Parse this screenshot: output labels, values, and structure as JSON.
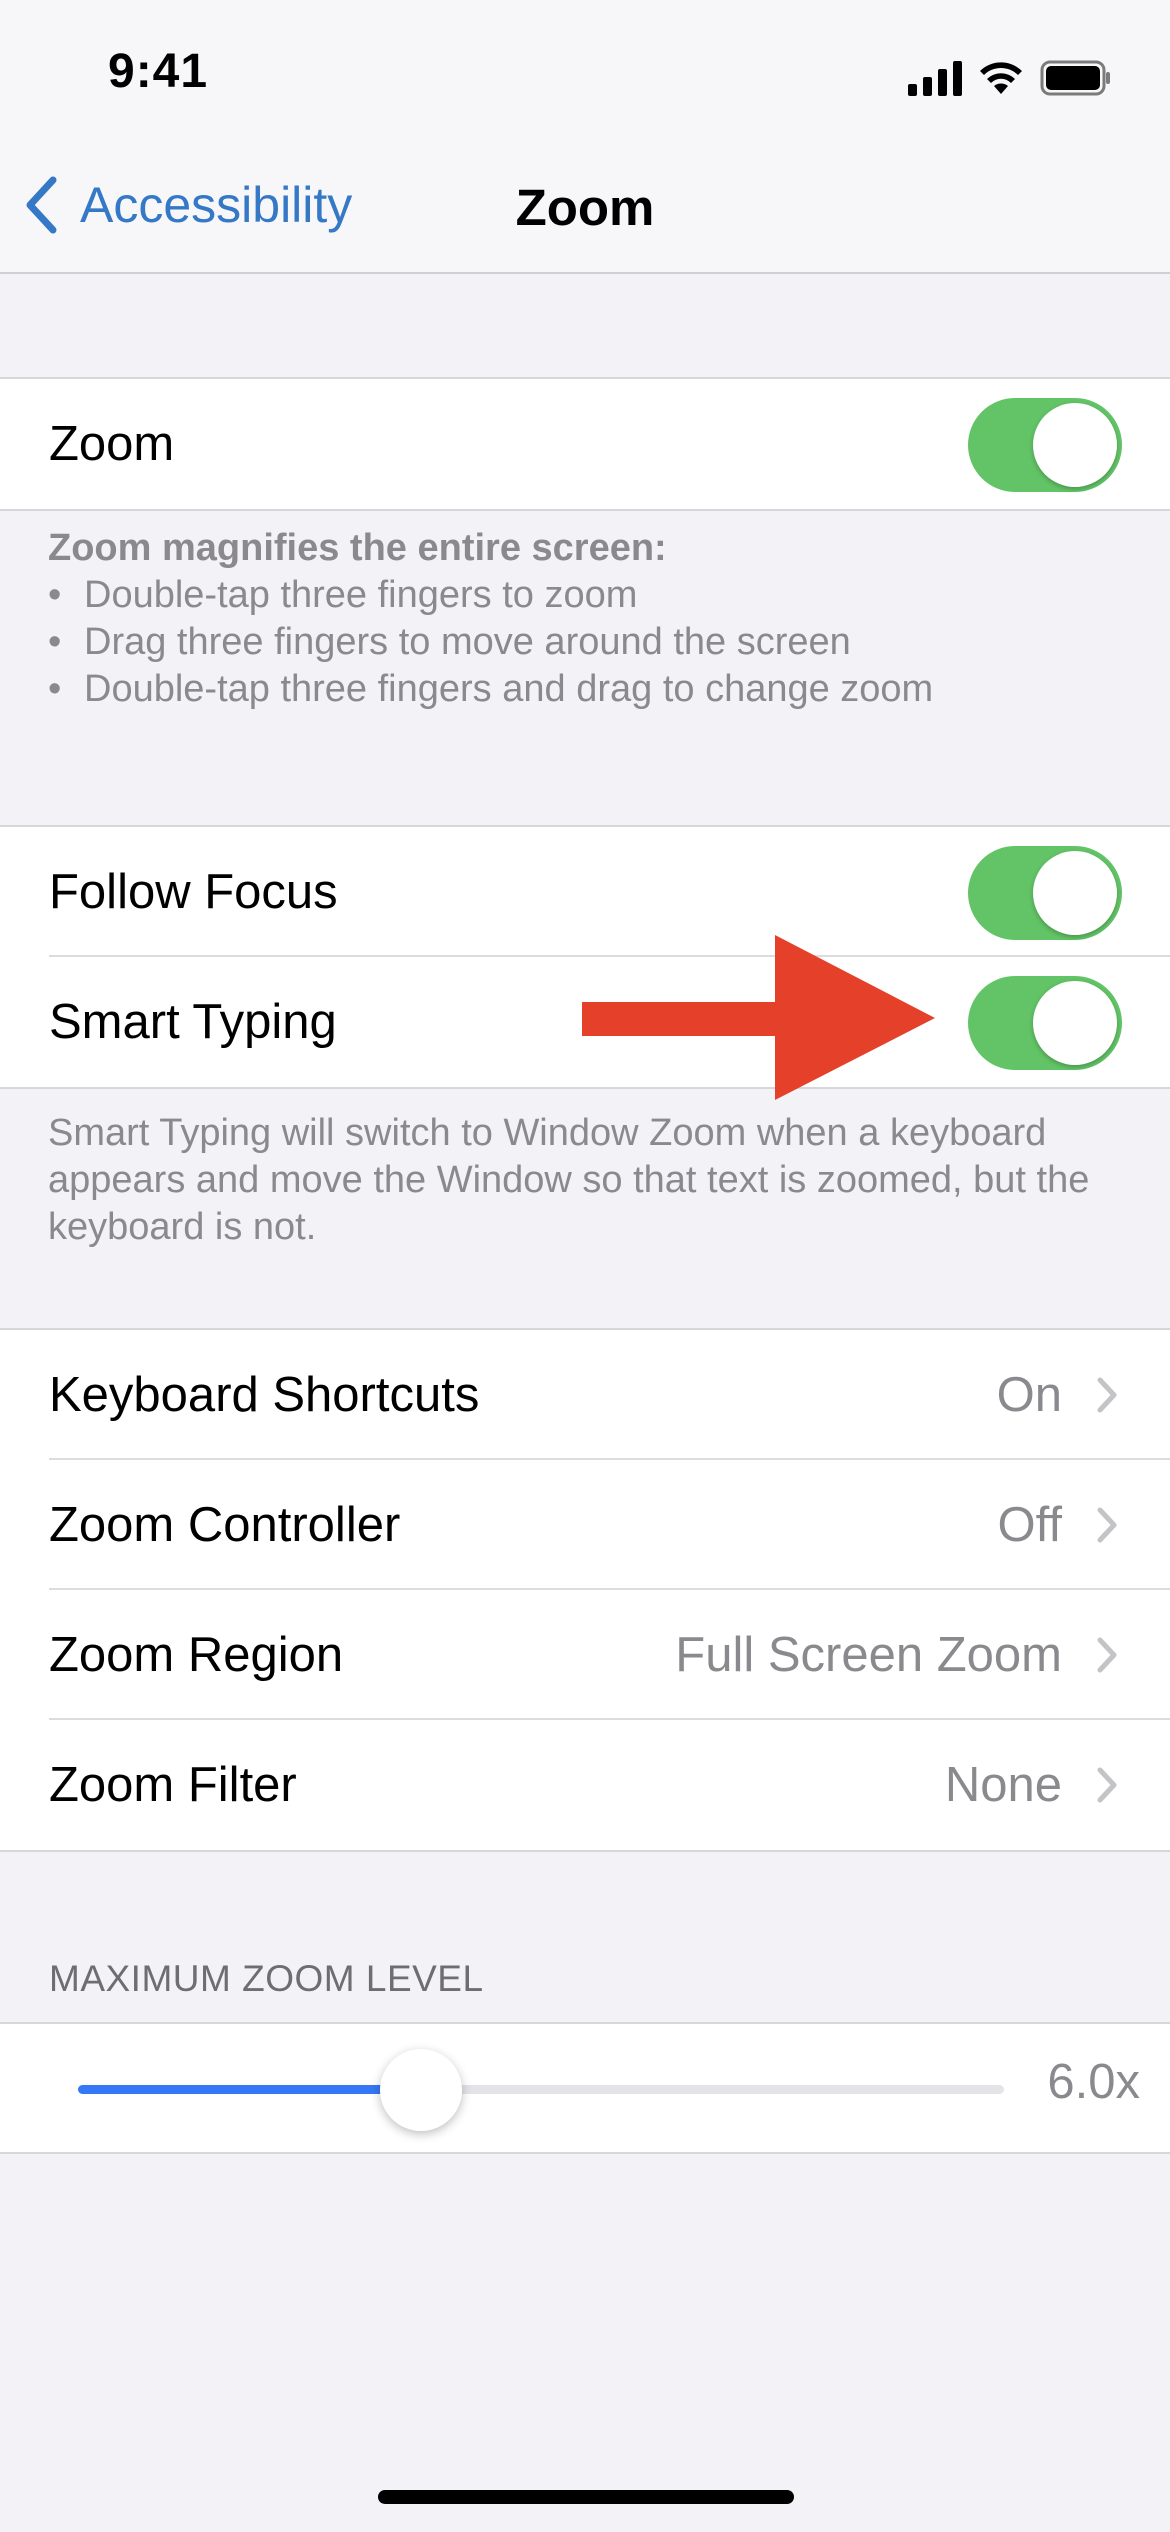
{
  "status_bar": {
    "time": "9:41"
  },
  "nav": {
    "back_label": "Accessibility",
    "title": "Zoom"
  },
  "zoom_group": {
    "label": "Zoom",
    "enabled": true
  },
  "zoom_footer": {
    "heading": "Zoom magnifies the entire screen:",
    "bullets": [
      "Double-tap three fingers to zoom",
      "Drag three fingers to move around the screen",
      "Double-tap three fingers and drag to change zoom"
    ]
  },
  "focus_group": {
    "follow_focus": {
      "label": "Follow Focus",
      "enabled": true
    },
    "smart_typing": {
      "label": "Smart Typing",
      "enabled": true
    }
  },
  "smart_typing_footer": "Smart Typing will switch to Window Zoom when a keyboard appears and move the Window so that text is zoomed, but the keyboard is not.",
  "settings_group": [
    {
      "label": "Keyboard Shortcuts",
      "value": "On"
    },
    {
      "label": "Zoom Controller",
      "value": "Off"
    },
    {
      "label": "Zoom Region",
      "value": "Full Screen Zoom"
    },
    {
      "label": "Zoom Filter",
      "value": "None"
    }
  ],
  "max_zoom": {
    "header": "MAXIMUM ZOOM LEVEL",
    "value_label": "6.0x",
    "slider_fraction": 0.37
  },
  "colors": {
    "accent": "#3478c6",
    "toggle_on": "#62c466",
    "arrow": "#e4402a"
  }
}
